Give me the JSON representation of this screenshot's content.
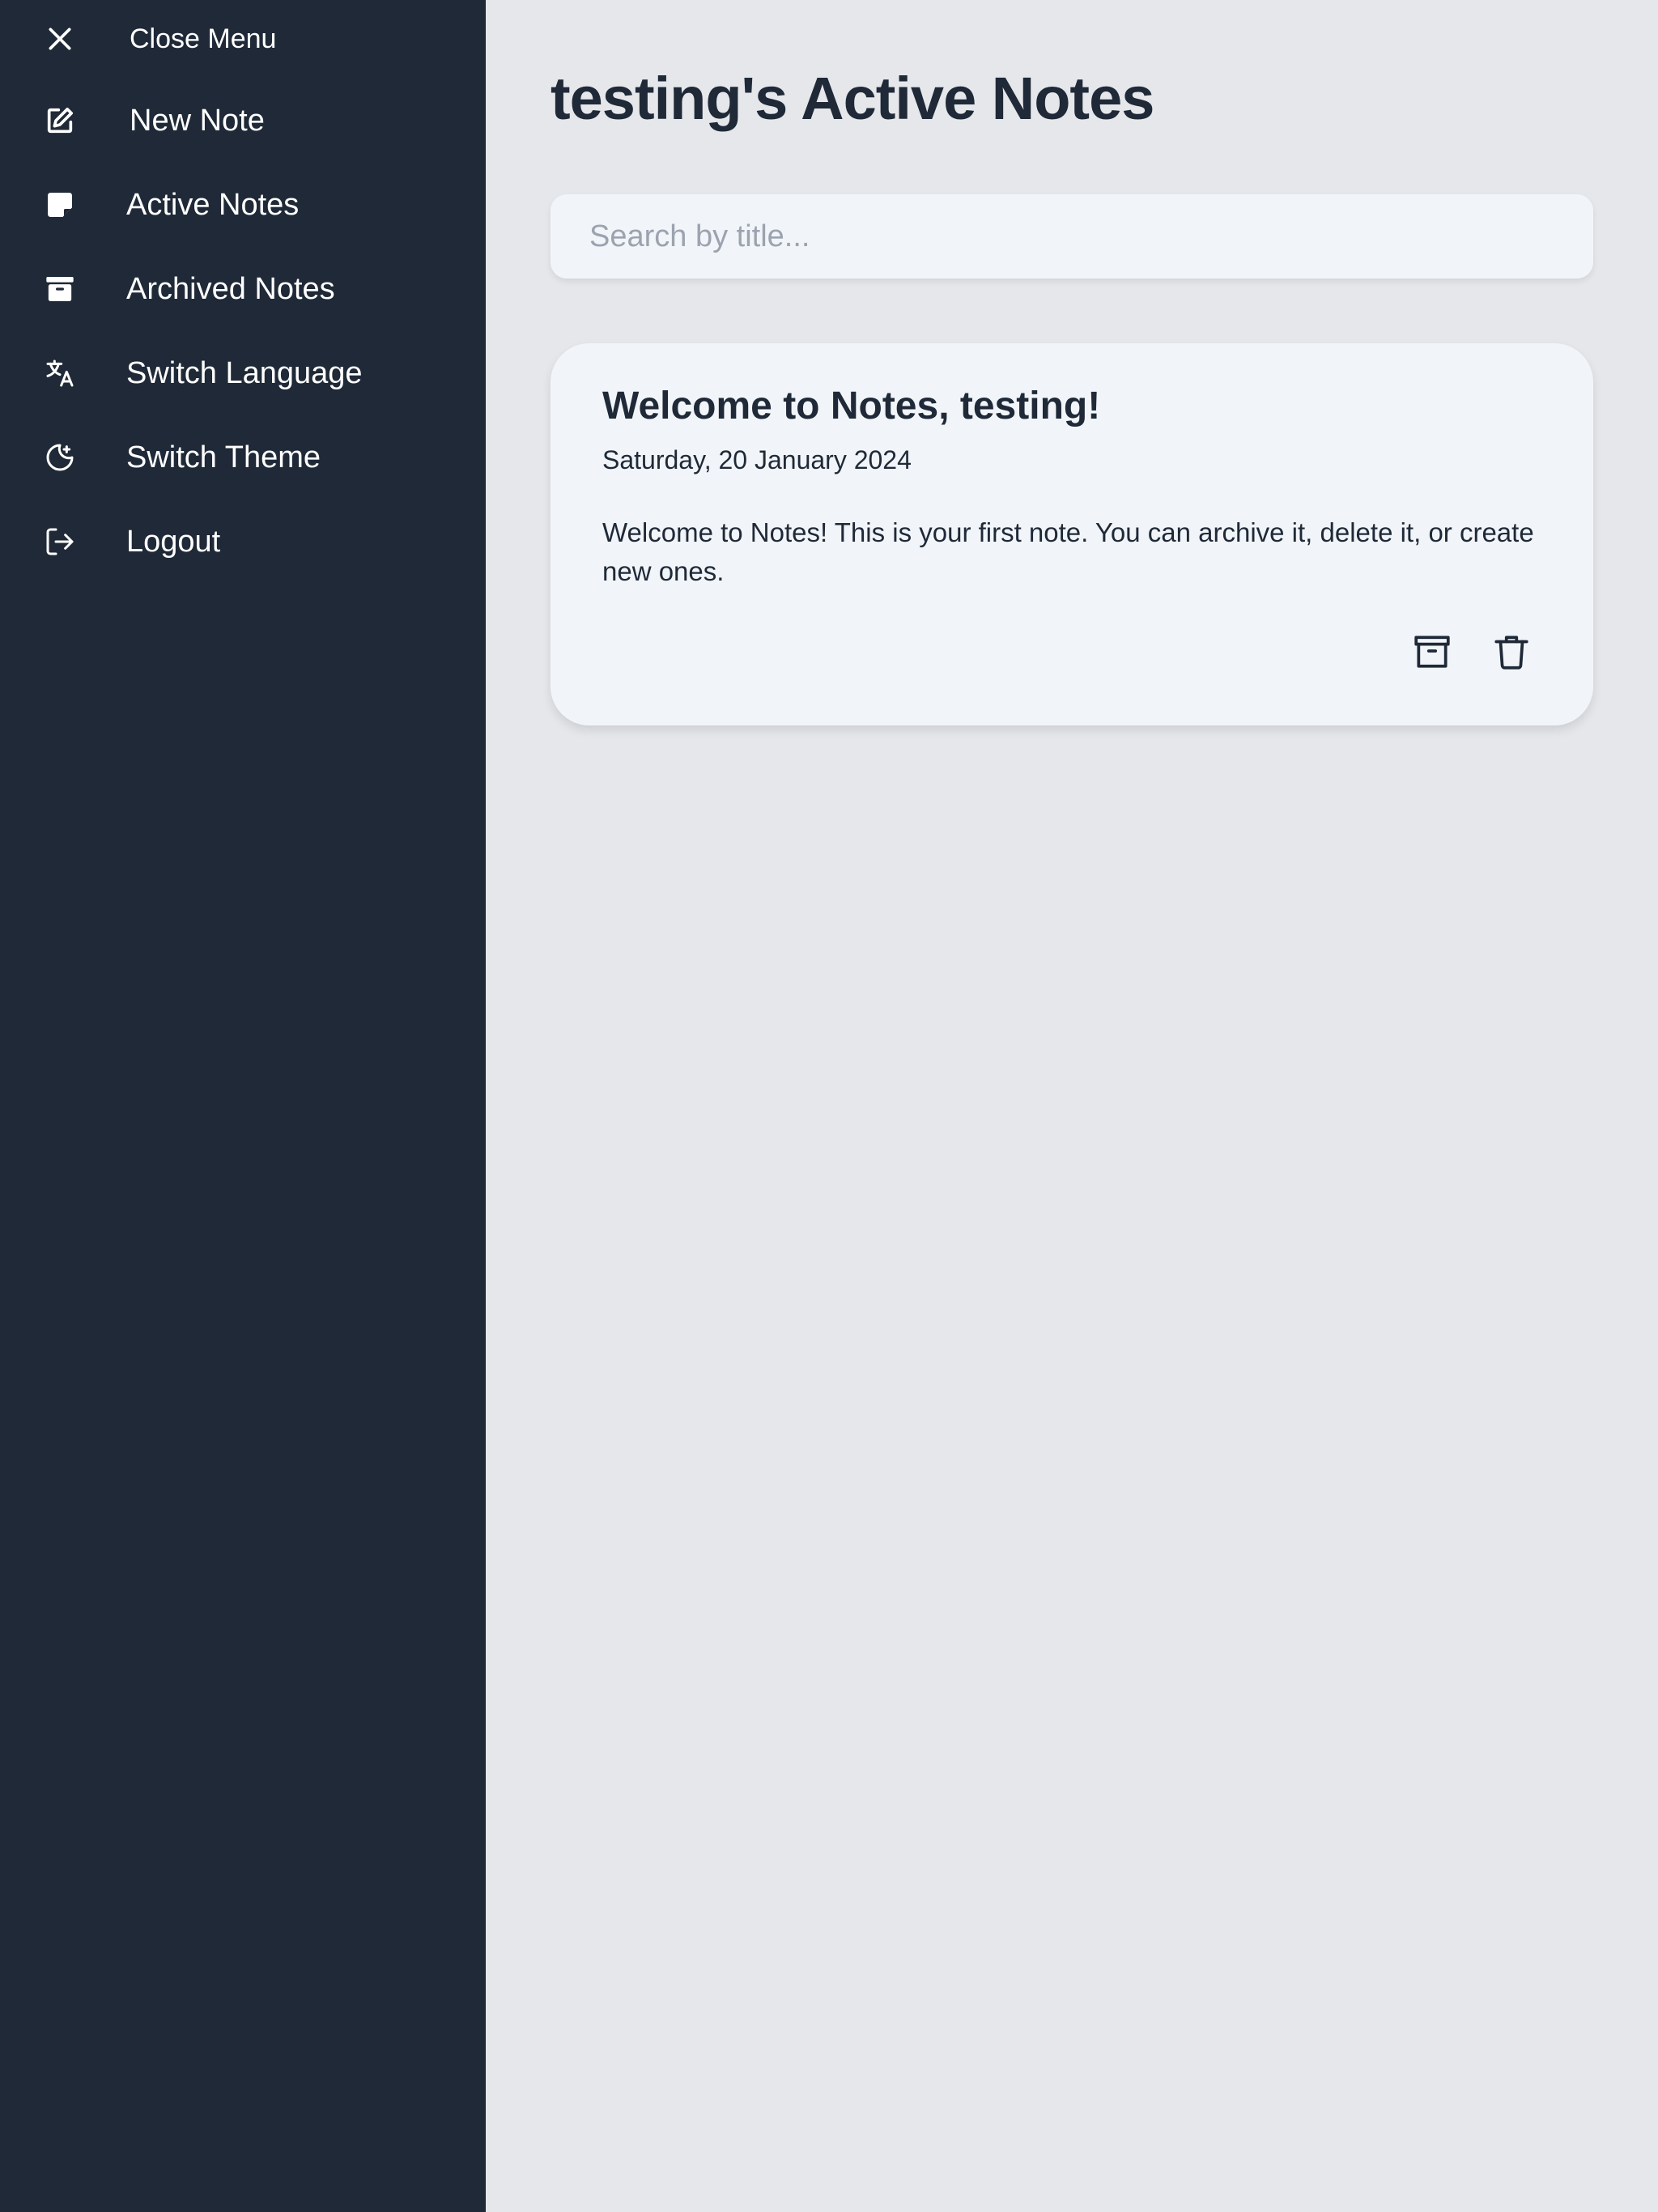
{
  "sidebar": {
    "items": [
      {
        "label": "Close Menu",
        "icon": "close-icon"
      },
      {
        "label": "New Note",
        "icon": "edit-icon"
      },
      {
        "label": "Active Notes",
        "icon": "note-icon"
      },
      {
        "label": "Archived Notes",
        "icon": "archive-icon"
      },
      {
        "label": "Switch Language",
        "icon": "translate-icon"
      },
      {
        "label": "Switch Theme",
        "icon": "moon-icon"
      },
      {
        "label": "Logout",
        "icon": "logout-icon"
      }
    ]
  },
  "main": {
    "title": "testing's Active Notes",
    "search": {
      "placeholder": "Search by title...",
      "value": ""
    },
    "notes": [
      {
        "title": "Welcome to Notes, testing!",
        "date": "Saturday, 20 January 2024",
        "body": "Welcome to Notes! This is your first note. You can archive it, delete it, or create new ones.",
        "actions": [
          "archive-icon",
          "trash-icon"
        ]
      }
    ]
  },
  "colors": {
    "sidebar_bg": "#1f2937",
    "page_bg": "#e5e7eb",
    "card_bg": "#f1f5f9",
    "text": "#1f2937",
    "placeholder": "#9ca3af"
  }
}
